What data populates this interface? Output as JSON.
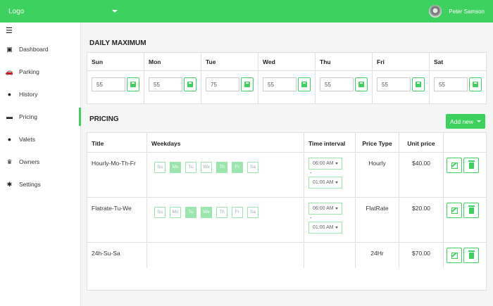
{
  "topbar": {
    "logo_label": "Logo",
    "user_name": "Peter Samson"
  },
  "sidebar": {
    "items": [
      {
        "label": "Dashboard",
        "icon": "image-icon"
      },
      {
        "label": "Parking",
        "icon": "car-icon"
      },
      {
        "label": "History",
        "icon": "clock-icon"
      },
      {
        "label": "Pricing",
        "icon": "price-icon"
      },
      {
        "label": "Valets",
        "icon": "user-icon"
      },
      {
        "label": "Owners",
        "icon": "crown-icon"
      },
      {
        "label": "Settings",
        "icon": "gear-icon"
      }
    ],
    "active": "Pricing"
  },
  "daily": {
    "title": "DAILY MAXIMUM",
    "days": [
      {
        "label": "Sun",
        "value": "55"
      },
      {
        "label": "Mon",
        "value": "55"
      },
      {
        "label": "Tue",
        "value": "75"
      },
      {
        "label": "Wed",
        "value": "55"
      },
      {
        "label": "Thu",
        "value": "55"
      },
      {
        "label": "Fri",
        "value": "55"
      },
      {
        "label": "Sat",
        "value": "55"
      }
    ]
  },
  "pricing": {
    "title": "PRICING",
    "add_label": "Add new",
    "headers": {
      "title": "Title",
      "weekdays": "Weekdays",
      "time": "Time interval",
      "ptype": "Price Type",
      "unit": "Unit price"
    },
    "day_labels": [
      "Su",
      "Mo",
      "Tu",
      "We",
      "Th",
      "Fr",
      "Sa"
    ],
    "rows": [
      {
        "title": "Hourly-Mo-Th-Fr",
        "active_days": [
          "Mo",
          "Th",
          "Fr"
        ],
        "start": "06:00 AM",
        "end": "01:00 AM",
        "type": "Hourly",
        "price": "$40.00",
        "show_days": true
      },
      {
        "title": "Flatrate-Tu-We",
        "active_days": [
          "Tu",
          "We"
        ],
        "start": "06:00 AM",
        "end": "01:00 AM",
        "type": "FlatRate",
        "price": "$20.00",
        "show_days": true
      },
      {
        "title": "24h-Su-Sa",
        "active_days": [],
        "start": "",
        "end": "",
        "type": "24Hr",
        "price": "$70.00",
        "show_days": false
      }
    ]
  },
  "colors": {
    "accent": "#3dd15e",
    "accent_light": "#9be6ac"
  }
}
